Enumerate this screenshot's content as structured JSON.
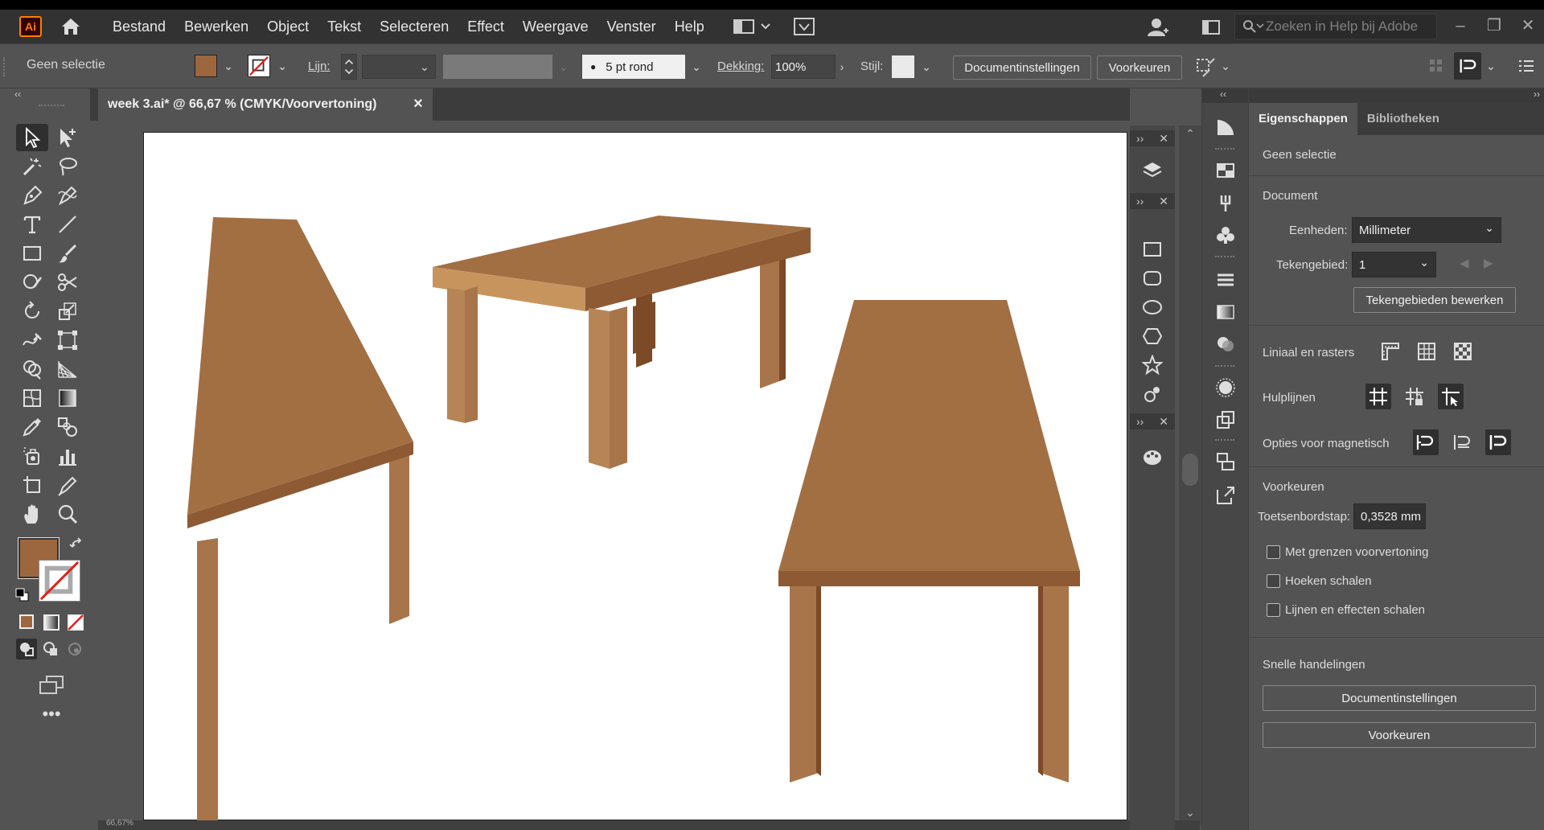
{
  "app": {
    "logo_text": "Ai",
    "menu": [
      "Bestand",
      "Bewerken",
      "Object",
      "Tekst",
      "Selecteren",
      "Effect",
      "Weergave",
      "Venster",
      "Help"
    ],
    "search_placeholder": "Zoeken in Help bij Adobe"
  },
  "controlbar": {
    "selection": "Geen selectie",
    "fill_color": "#9c673e",
    "stroke_label": "Lijn:",
    "brush_label": "5 pt rond",
    "opacity_label": "Dekking:",
    "opacity_value": "100%",
    "style_label": "Stijl:",
    "doc_settings_button": "Documentinstellingen",
    "preferences_button": "Voorkeuren"
  },
  "document": {
    "tab_title": "week 3.ai* @ 66,67 % (CMYK/Voorvertoning)",
    "zoom_status": "66,67%"
  },
  "artwork": {
    "table_colors": {
      "top": "#a26f43",
      "top_light": "#c8945e",
      "edge": "#8e5a34",
      "leg": "#a8754a",
      "leg_dark": "#7c4a26",
      "leg_light": "#b78456"
    }
  },
  "properties_panel": {
    "tabs": [
      "Eigenschappen",
      "Bibliotheken"
    ],
    "selection_status": "Geen selectie",
    "document_section": "Document",
    "units_label": "Eenheden:",
    "units_value": "Millimeter",
    "artboard_label": "Tekengebied:",
    "artboard_value": "1",
    "edit_artboards_button": "Tekengebieden bewerken",
    "rulers_label": "Liniaal en rasters",
    "guides_label": "Hulplijnen",
    "snap_label": "Opties voor magnetisch",
    "preferences_section": "Voorkeuren",
    "keyboard_increment_label": "Toetsenbordstap:",
    "keyboard_increment_value": "0,3528 mm",
    "checkboxes": [
      "Met grenzen voorvertoning",
      "Hoeken schalen",
      "Lijnen en effecten schalen"
    ],
    "quick_actions_label": "Snelle handelingen",
    "quick_actions": [
      "Documentinstellingen",
      "Voorkeuren"
    ]
  }
}
